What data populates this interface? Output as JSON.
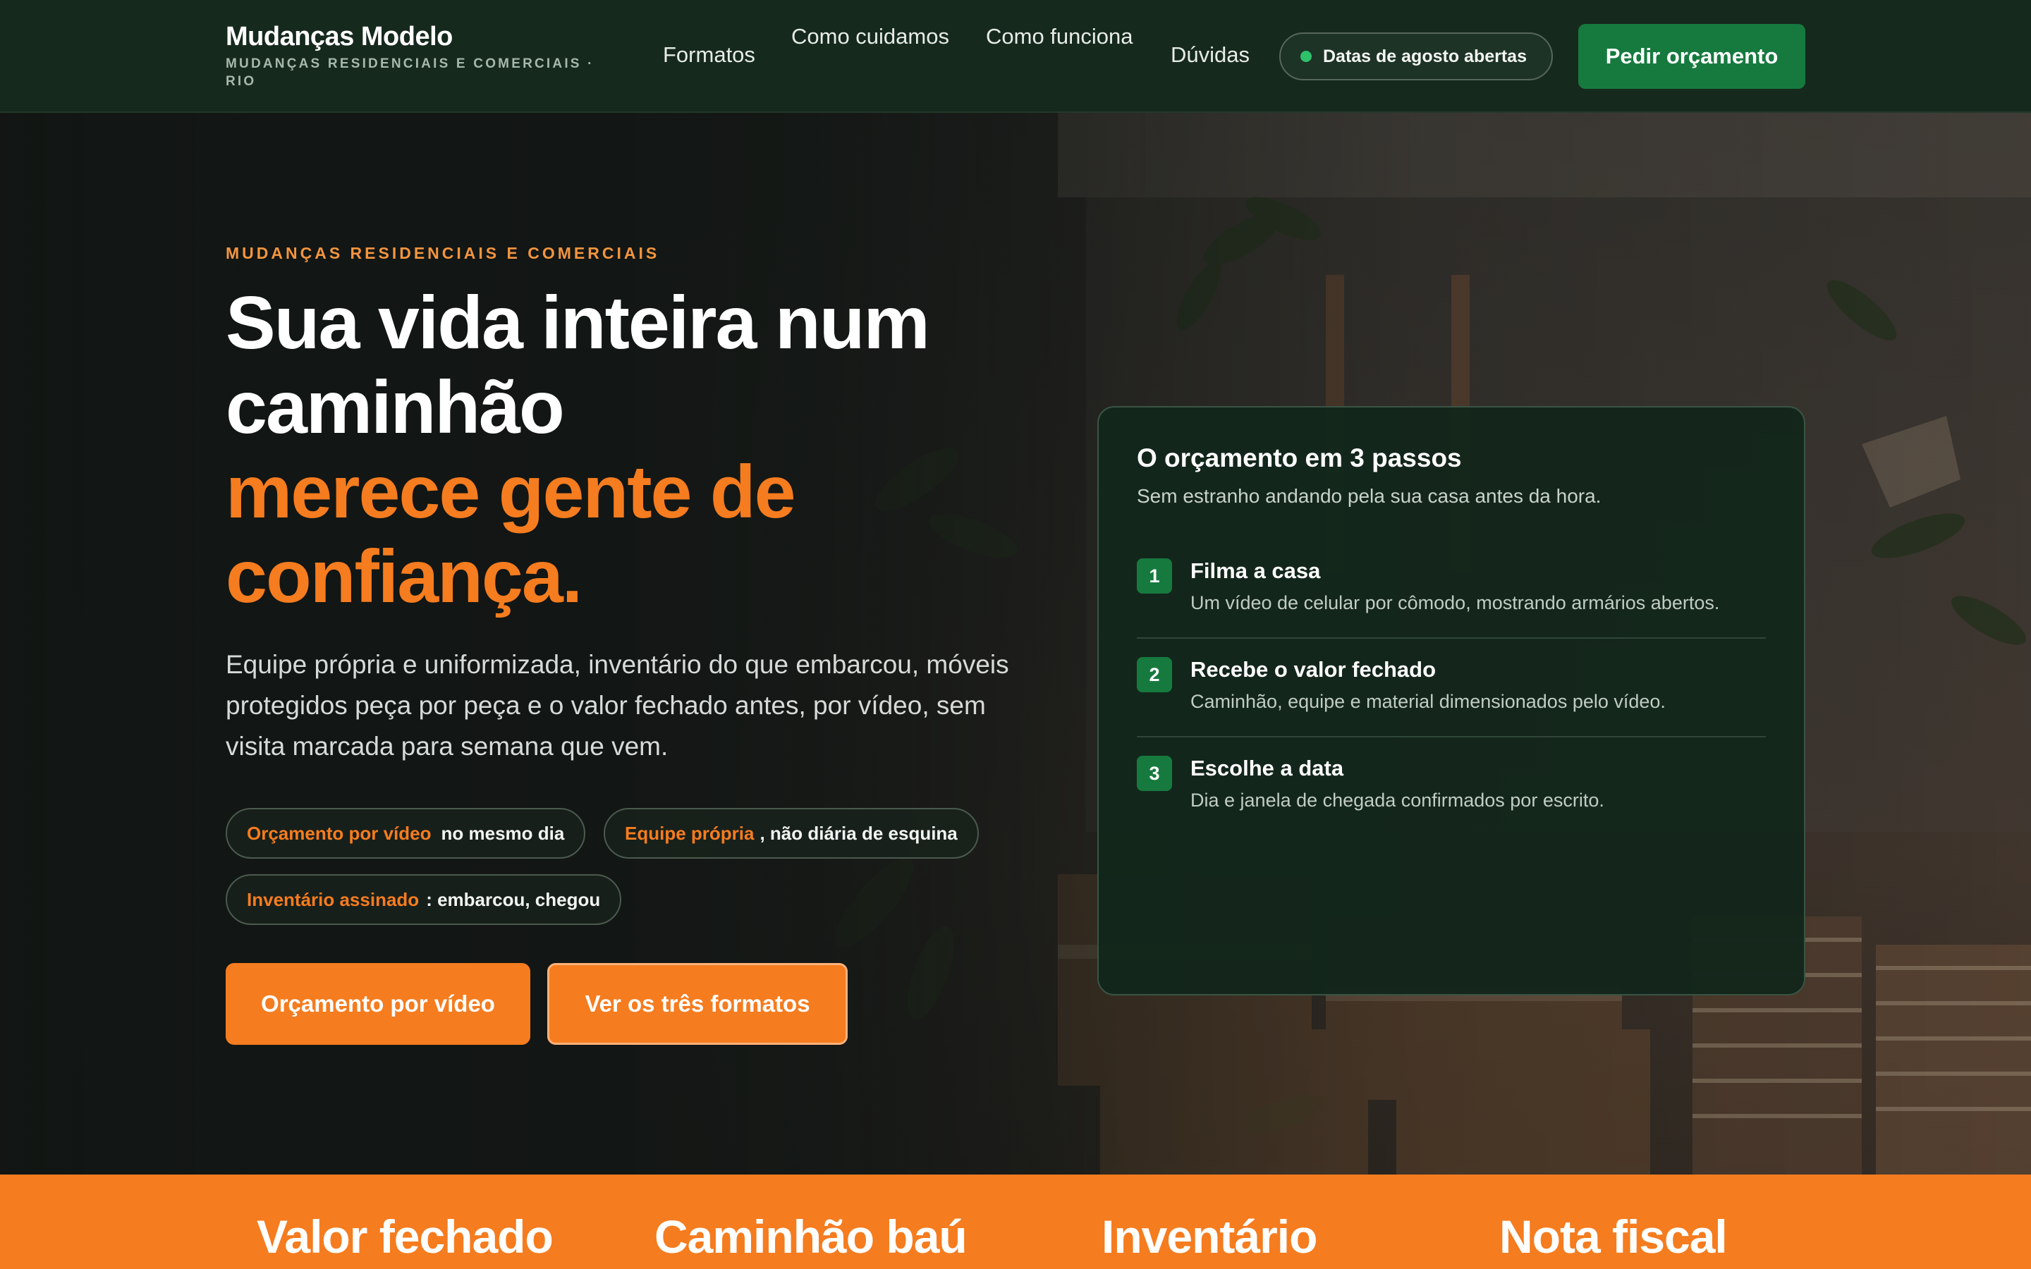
{
  "nav": {
    "brand_name": "Mudanças Modelo",
    "brand_tagline": "MUDANÇAS RESIDENCIAIS E COMERCIAIS · RIO",
    "links": [
      "Formatos",
      "Como cuidamos",
      "Como funciona",
      "Dúvidas"
    ],
    "badge": "Datas de agosto abertas",
    "cta": "Pedir orçamento"
  },
  "hero": {
    "eyebrow": "MUDANÇAS RESIDENCIAIS E COMERCIAIS",
    "headline_white": "Sua vida inteira num caminhão",
    "headline_orange": "merece gente de confiança.",
    "lede": "Equipe própria e uniformizada, inventário do que embarcou, móveis protegidos peça por peça e o valor fechado antes, por vídeo, sem visita marcada para semana que vem.",
    "pills": [
      {
        "highlight": "Orçamento por vídeo",
        "rest": "no mesmo dia"
      },
      {
        "highlight": "Equipe própria",
        "rest": ", não diária de esquina"
      },
      {
        "highlight": "Inventário assinado",
        "rest": ": embarcou, chegou"
      }
    ],
    "primary_button": "Orçamento por vídeo",
    "secondary_button": "Ver os três formatos"
  },
  "steps_card": {
    "title": "O orçamento em 3 passos",
    "subtitle": "Sem estranho andando pela sua casa antes da hora.",
    "steps": [
      {
        "number": "1",
        "title": "Filma a casa",
        "description": "Um vídeo de celular por cômodo, mostrando armários abertos."
      },
      {
        "number": "2",
        "title": "Recebe o valor fechado",
        "description": "Caminhão, equipe e material dimensionados pelo vídeo."
      },
      {
        "number": "3",
        "title": "Escolhe a data",
        "description": "Dia e janela de chegada confirmados por escrito."
      }
    ]
  },
  "strip": {
    "items": [
      "Valor fechado",
      "Caminhão baú",
      "Inventário",
      "Nota fiscal"
    ]
  },
  "colors": {
    "nav_bg": "#16291d",
    "accent_orange": "#f57c1f",
    "accent_green": "#167a3f",
    "status_dot": "#2fc16a"
  }
}
